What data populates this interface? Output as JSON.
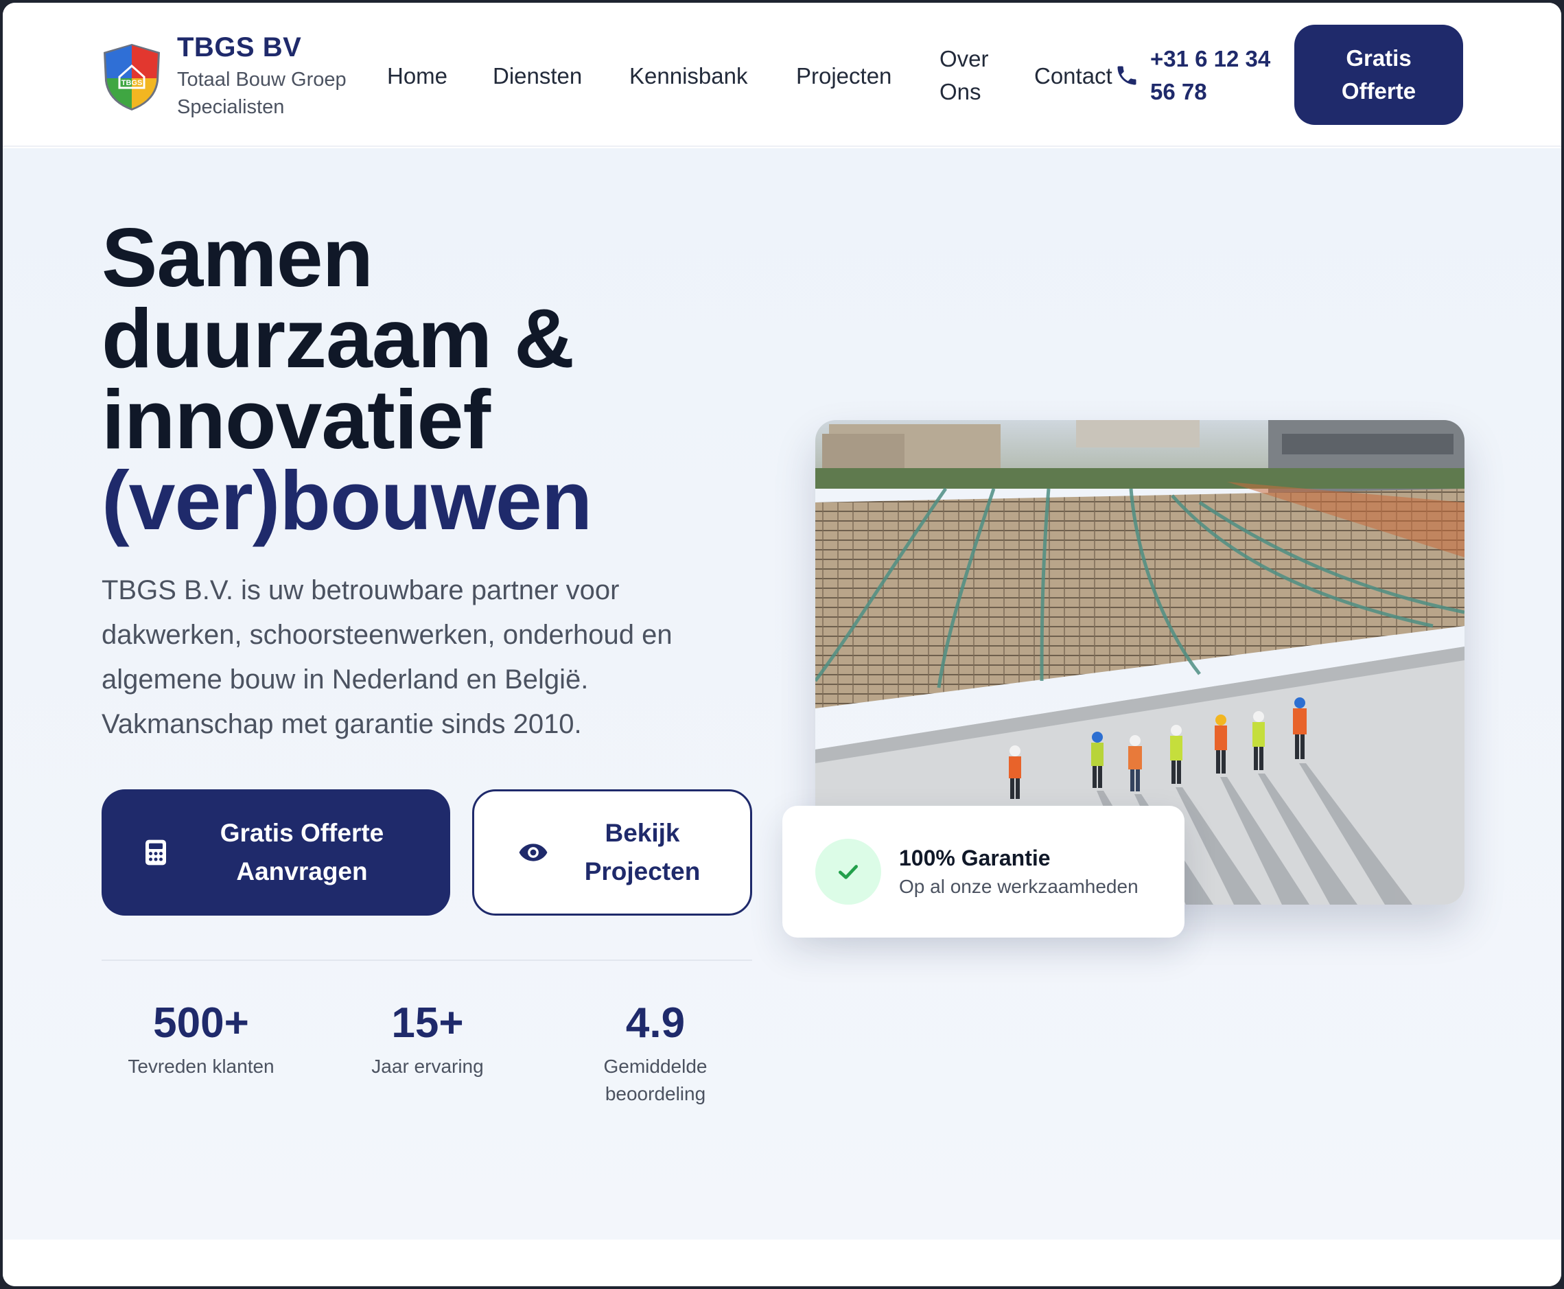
{
  "brand": {
    "name": "TBGS BV",
    "tagline": "Totaal Bouw Groep Specialisten",
    "logo_text": "TBGS"
  },
  "nav": {
    "items": [
      {
        "label": "Home"
      },
      {
        "label": "Diensten"
      },
      {
        "label": "Kennisbank"
      },
      {
        "label": "Projecten"
      },
      {
        "label": "Over Ons"
      },
      {
        "label": "Contact"
      }
    ],
    "phone": "+31 6 12 34 56 78",
    "cta": "Gratis Offerte"
  },
  "hero": {
    "headline_line1": "Samen",
    "headline_line2": "duurzaam &",
    "headline_line3": "innovatief",
    "headline_accent": "(ver)bouwen",
    "intro": "TBGS B.V. is uw betrouwbare partner voor dakwerken, schoorsteenwerken, onderhoud en algemene bouw in Nederland en België. Vakmanschap met garantie sinds 2010.",
    "primary_button": "Gratis Offerte Aanvragen",
    "secondary_button": "Bekijk Projecten",
    "stats": [
      {
        "value": "500+",
        "label": "Tevreden klanten"
      },
      {
        "value": "15+",
        "label": "Jaar ervaring"
      },
      {
        "value": "4.9",
        "label": "Gemiddelde beoordeling"
      }
    ]
  },
  "badge": {
    "title": "100% Garantie",
    "subtitle": "Op al onze werkzaamheden"
  },
  "colors": {
    "brand_navy": "#1f2a6b",
    "text_dark": "#101828",
    "text_muted": "#4b5260",
    "success_bg": "#dcfce7",
    "success": "#22a04b"
  },
  "icons": {
    "logo": "shield-logo-icon",
    "phone": "phone-icon",
    "calculator": "calculator-icon",
    "eye": "eye-icon",
    "check": "check-icon"
  }
}
